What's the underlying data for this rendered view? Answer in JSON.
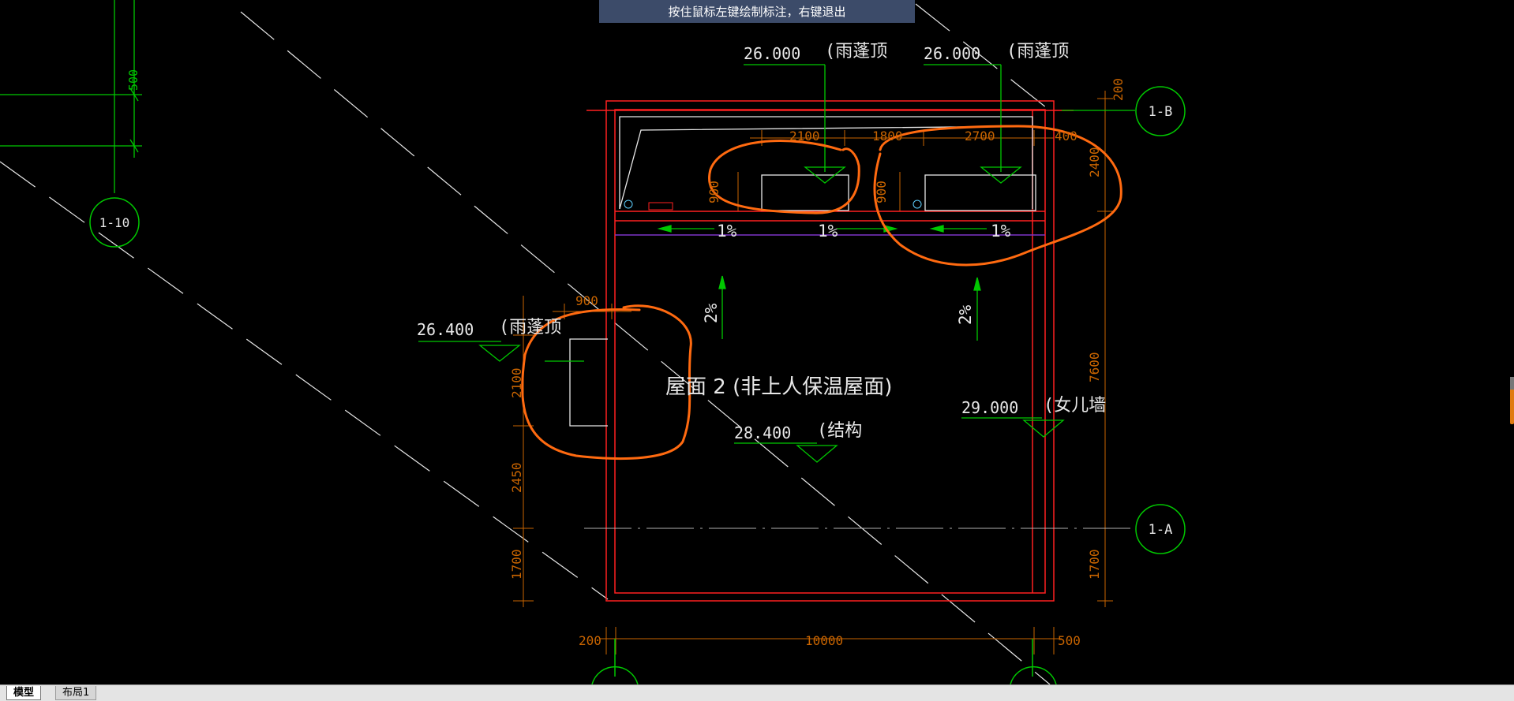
{
  "hint": "按住鼠标左键绘制标注，右键退出",
  "tabs": {
    "model": "模型",
    "layout1": "布局1"
  },
  "axes": {
    "a1": "1-A",
    "b1": "1-B",
    "c10": "1-10"
  },
  "elevations": {
    "e1_value": "26.000",
    "e1_note": "(雨蓬顶",
    "e2_value": "26.000",
    "e2_note": "(雨蓬顶",
    "e3_value": "26.400",
    "e3_note": "(雨蓬顶",
    "e4_value": "28.400",
    "e4_note": "(结构",
    "e5_value": "29.000",
    "e5_note": "(女儿墙"
  },
  "room_label": "屋面 2 (非上人保温屋面)",
  "slopes": {
    "s1": "1%",
    "s2": "1%",
    "s3": "1%",
    "s4": "2%",
    "s5": "2%"
  },
  "dims": {
    "d500": "500",
    "d200top": "200",
    "d2100": "2100",
    "d1800": "1800",
    "d2700": "2700",
    "d400": "400",
    "d2400": "2400",
    "d900a": "900",
    "d900b": "900",
    "d900c": "900",
    "d2100v": "2100",
    "d7600": "7600",
    "d2450": "2450",
    "d1700l": "1700",
    "d1700r": "1700",
    "d200bottom": "200",
    "d10000": "10000",
    "d500bottom": "500"
  },
  "colors": {
    "background": "#000000",
    "grid_axis": "#00c800",
    "wall": "#ff2020",
    "dimension": "#c86400",
    "markup": "#ff6a10",
    "text": "#ffffff"
  }
}
